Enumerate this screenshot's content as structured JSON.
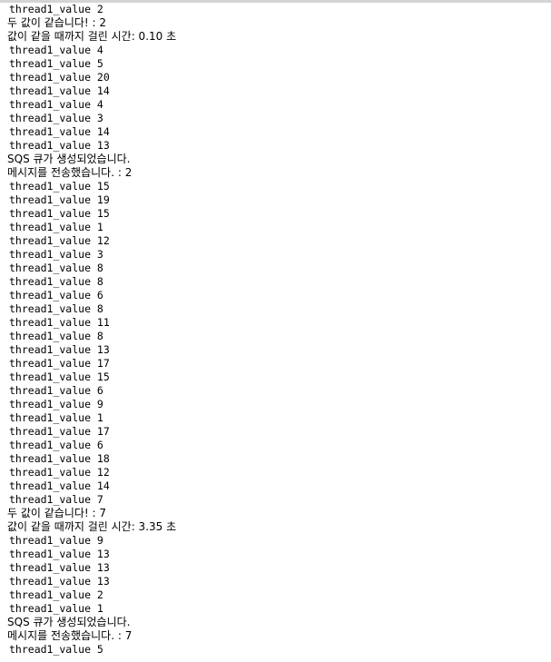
{
  "console": {
    "background_color": "#ffffff",
    "text_color": "#000000",
    "top_strip_color": "#d4d4d4",
    "lines": [
      {
        "text": "thread1_value 2",
        "kind": "value"
      },
      {
        "text": "두 값이 같습니다! : 2",
        "kind": "korean"
      },
      {
        "text": "값이 같을 때까지 걸린 시간: 0.10 초",
        "kind": "korean"
      },
      {
        "text": "thread1_value 4",
        "kind": "value"
      },
      {
        "text": "thread1_value 5",
        "kind": "value"
      },
      {
        "text": "thread1_value 20",
        "kind": "value"
      },
      {
        "text": "thread1_value 14",
        "kind": "value"
      },
      {
        "text": "thread1_value 4",
        "kind": "value"
      },
      {
        "text": "thread1_value 3",
        "kind": "value"
      },
      {
        "text": "thread1_value 14",
        "kind": "value"
      },
      {
        "text": "thread1_value 13",
        "kind": "value"
      },
      {
        "text": "SQS 큐가 생성되었습니다.",
        "kind": "mixed"
      },
      {
        "text": "메시지를 전송했습니다. : 2",
        "kind": "korean"
      },
      {
        "text": "thread1_value 15",
        "kind": "value"
      },
      {
        "text": "thread1_value 19",
        "kind": "value"
      },
      {
        "text": "thread1_value 15",
        "kind": "value"
      },
      {
        "text": "thread1_value 1",
        "kind": "value"
      },
      {
        "text": "thread1_value 12",
        "kind": "value"
      },
      {
        "text": "thread1_value 3",
        "kind": "value"
      },
      {
        "text": "thread1_value 8",
        "kind": "value"
      },
      {
        "text": "thread1_value 8",
        "kind": "value"
      },
      {
        "text": "thread1_value 6",
        "kind": "value"
      },
      {
        "text": "thread1_value 8",
        "kind": "value"
      },
      {
        "text": "thread1_value 11",
        "kind": "value"
      },
      {
        "text": "thread1_value 8",
        "kind": "value"
      },
      {
        "text": "thread1_value 13",
        "kind": "value"
      },
      {
        "text": "thread1_value 17",
        "kind": "value"
      },
      {
        "text": "thread1_value 15",
        "kind": "value"
      },
      {
        "text": "thread1_value 6",
        "kind": "value"
      },
      {
        "text": "thread1_value 9",
        "kind": "value"
      },
      {
        "text": "thread1_value 1",
        "kind": "value"
      },
      {
        "text": "thread1_value 17",
        "kind": "value"
      },
      {
        "text": "thread1_value 6",
        "kind": "value"
      },
      {
        "text": "thread1_value 18",
        "kind": "value"
      },
      {
        "text": "thread1_value 12",
        "kind": "value"
      },
      {
        "text": "thread1_value 14",
        "kind": "value"
      },
      {
        "text": "thread1_value 7",
        "kind": "value"
      },
      {
        "text": "두 값이 같습니다! : 7",
        "kind": "korean"
      },
      {
        "text": "값이 같을 때까지 걸린 시간: 3.35 초",
        "kind": "korean"
      },
      {
        "text": "thread1_value 9",
        "kind": "value"
      },
      {
        "text": "thread1_value 13",
        "kind": "value"
      },
      {
        "text": "thread1_value 13",
        "kind": "value"
      },
      {
        "text": "thread1_value 13",
        "kind": "value"
      },
      {
        "text": "thread1_value 2",
        "kind": "value"
      },
      {
        "text": "thread1_value 1",
        "kind": "value"
      },
      {
        "text": "SQS 큐가 생성되었습니다.",
        "kind": "mixed"
      },
      {
        "text": "메시지를 전송했습니다. : 7",
        "kind": "korean"
      },
      {
        "text": "thread1_value 5",
        "kind": "value"
      }
    ]
  }
}
